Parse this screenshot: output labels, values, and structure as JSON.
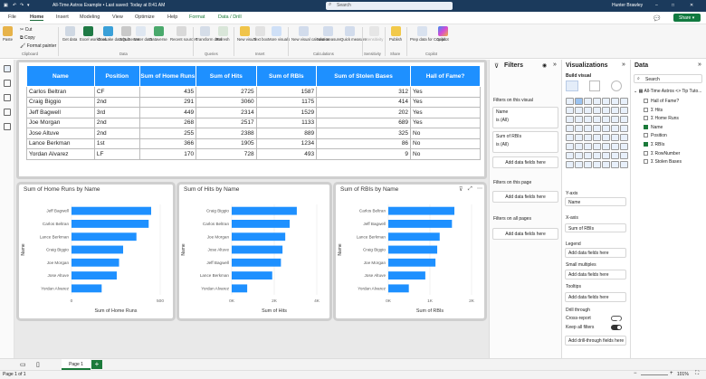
{
  "titlebar": {
    "title": "All-Time Astros Example • Last saved: Today at 8:41 AM",
    "search": "Search",
    "user": "Hunter Brawley"
  },
  "menu": {
    "items": [
      "File",
      "Home",
      "Insert",
      "Modeling",
      "View",
      "Optimize",
      "Help",
      "Format",
      "Data / Drill"
    ],
    "share": "Share"
  },
  "ribbon": {
    "clipboard": {
      "paste": "Paste",
      "cut": "Cut",
      "copy": "Copy",
      "format_painter": "Format painter",
      "group": "Clipboard"
    },
    "data_buttons": [
      "Get data",
      "Excel workbook",
      "OneLake data hub",
      "SQL Server",
      "Enter data",
      "Dataverse",
      "Recent sources"
    ],
    "data_group": "Data",
    "queries_buttons": [
      "Transform data",
      "Refresh"
    ],
    "queries_group": "Queries",
    "insert_buttons": [
      "New visual",
      "Text box",
      "More visuals"
    ],
    "insert_group": "Insert",
    "calc_buttons": [
      "New visual calculation",
      "New measure",
      "Quick measure"
    ],
    "calc_group": "Calculations",
    "sensitivity": "Sensitivity",
    "sensitivity_group": "Sensitivity",
    "publish": "Publish",
    "share_group": "Share",
    "copilot": "Prep data for Copilot",
    "copilot_btn": "Copilot",
    "copilot_group": "Copilot"
  },
  "table": {
    "columns": [
      "Name",
      "Position",
      "Sum of Home Runs",
      "Sum of Hits",
      "Sum of RBIs",
      "Sum of Stolen Bases",
      "Hall of Fame?"
    ],
    "rows": [
      [
        "Carlos Beltran",
        "CF",
        "435",
        "2725",
        "1587",
        "312",
        "Yes"
      ],
      [
        "Craig Biggio",
        "2nd",
        "291",
        "3060",
        "1175",
        "414",
        "Yes"
      ],
      [
        "Jeff Bagwell",
        "3rd",
        "449",
        "2314",
        "1529",
        "202",
        "Yes"
      ],
      [
        "Joe Morgan",
        "2nd",
        "268",
        "2517",
        "1133",
        "689",
        "Yes"
      ],
      [
        "Jose Altuve",
        "2nd",
        "255",
        "2388",
        "889",
        "325",
        "No"
      ],
      [
        "Lance Berkman",
        "1st",
        "366",
        "1905",
        "1234",
        "86",
        "No"
      ],
      [
        "Yordan Alvarez",
        "LF",
        "170",
        "728",
        "493",
        "9",
        "No"
      ]
    ]
  },
  "chart_data": [
    {
      "type": "bar",
      "title": "Sum of Home Runs by Name",
      "xlabel": "Sum of Home Runs",
      "ylabel": "Name",
      "categories": [
        "Jeff Bagwell",
        "Carlos Beltran",
        "Lance Berkman",
        "Craig Biggio",
        "Joe Morgan",
        "Jose Altuve",
        "Yordan Alvarez"
      ],
      "values": [
        449,
        435,
        366,
        291,
        268,
        255,
        170
      ],
      "xlim": [
        0,
        500
      ],
      "ticks": [
        "0",
        "500"
      ],
      "color": "#1e90ff"
    },
    {
      "type": "bar",
      "title": "Sum of Hits by Name",
      "xlabel": "Sum of Hits",
      "ylabel": "Name",
      "categories": [
        "Craig Biggio",
        "Carlos Beltran",
        "Joe Morgan",
        "Jose Altuve",
        "Jeff Bagwell",
        "Lance Berkman",
        "Yordan Alvarez"
      ],
      "values": [
        3060,
        2725,
        2517,
        2388,
        2314,
        1905,
        728
      ],
      "xlim": [
        0,
        4000
      ],
      "ticks": [
        "0K",
        "2K",
        "4K"
      ],
      "color": "#1e90ff"
    },
    {
      "type": "bar",
      "title": "Sum of RBIs by Name",
      "xlabel": "Sum of RBIs",
      "ylabel": "Name",
      "categories": [
        "Carlos Beltran",
        "Jeff Bagwell",
        "Lance Berkman",
        "Craig Biggio",
        "Joe Morgan",
        "Jose Altuve",
        "Yordan Alvarez"
      ],
      "values": [
        1587,
        1529,
        1234,
        1175,
        1133,
        889,
        493
      ],
      "xlim": [
        0,
        2000
      ],
      "ticks": [
        "0K",
        "1K",
        "2K"
      ],
      "color": "#1e90ff"
    }
  ],
  "filters": {
    "title": "Filters",
    "on_visual": "Filters on this visual",
    "f1_name": "Name",
    "f1_val": "is (All)",
    "f2_name": "Sum of RBIs",
    "f2_val": "is (All)",
    "add": "Add data fields here",
    "on_page": "Filters on this page",
    "on_all": "Filters on all pages"
  },
  "viz": {
    "title": "Visualizations",
    "build": "Build visual",
    "yaxis": "Y-axis",
    "yaxis_val": "Name",
    "xaxis": "X-axis",
    "xaxis_val": "Sum of RBIs",
    "legend": "Legend",
    "small_multiples": "Small multiples",
    "tooltips": "Tooltips",
    "add": "Add data fields here",
    "drill": "Drill through",
    "cross_report": "Cross-report",
    "keep_filters": "Keep all filters",
    "add_drill": "Add drill-through fields here",
    "cross_state": "Off",
    "keep_state": "On"
  },
  "data_pane": {
    "title": "Data",
    "search": "Search",
    "table_name": "All-Time Astros <> Tip Tuto...",
    "fields": [
      {
        "label": "Hall of Fame?",
        "checked": false,
        "sigma": false
      },
      {
        "label": "Hits",
        "checked": false,
        "sigma": true
      },
      {
        "label": "Home Runs",
        "checked": false,
        "sigma": true
      },
      {
        "label": "Name",
        "checked": true,
        "sigma": false
      },
      {
        "label": "Position",
        "checked": false,
        "sigma": false
      },
      {
        "label": "RBIs",
        "checked": true,
        "sigma": true
      },
      {
        "label": "RowNumber",
        "checked": false,
        "sigma": true
      },
      {
        "label": "Stolen Bases",
        "checked": false,
        "sigma": true
      }
    ]
  },
  "pages": {
    "tab": "Page 1",
    "add": "+"
  },
  "status": {
    "page": "Page 1 of 1",
    "zoom": "101%"
  }
}
